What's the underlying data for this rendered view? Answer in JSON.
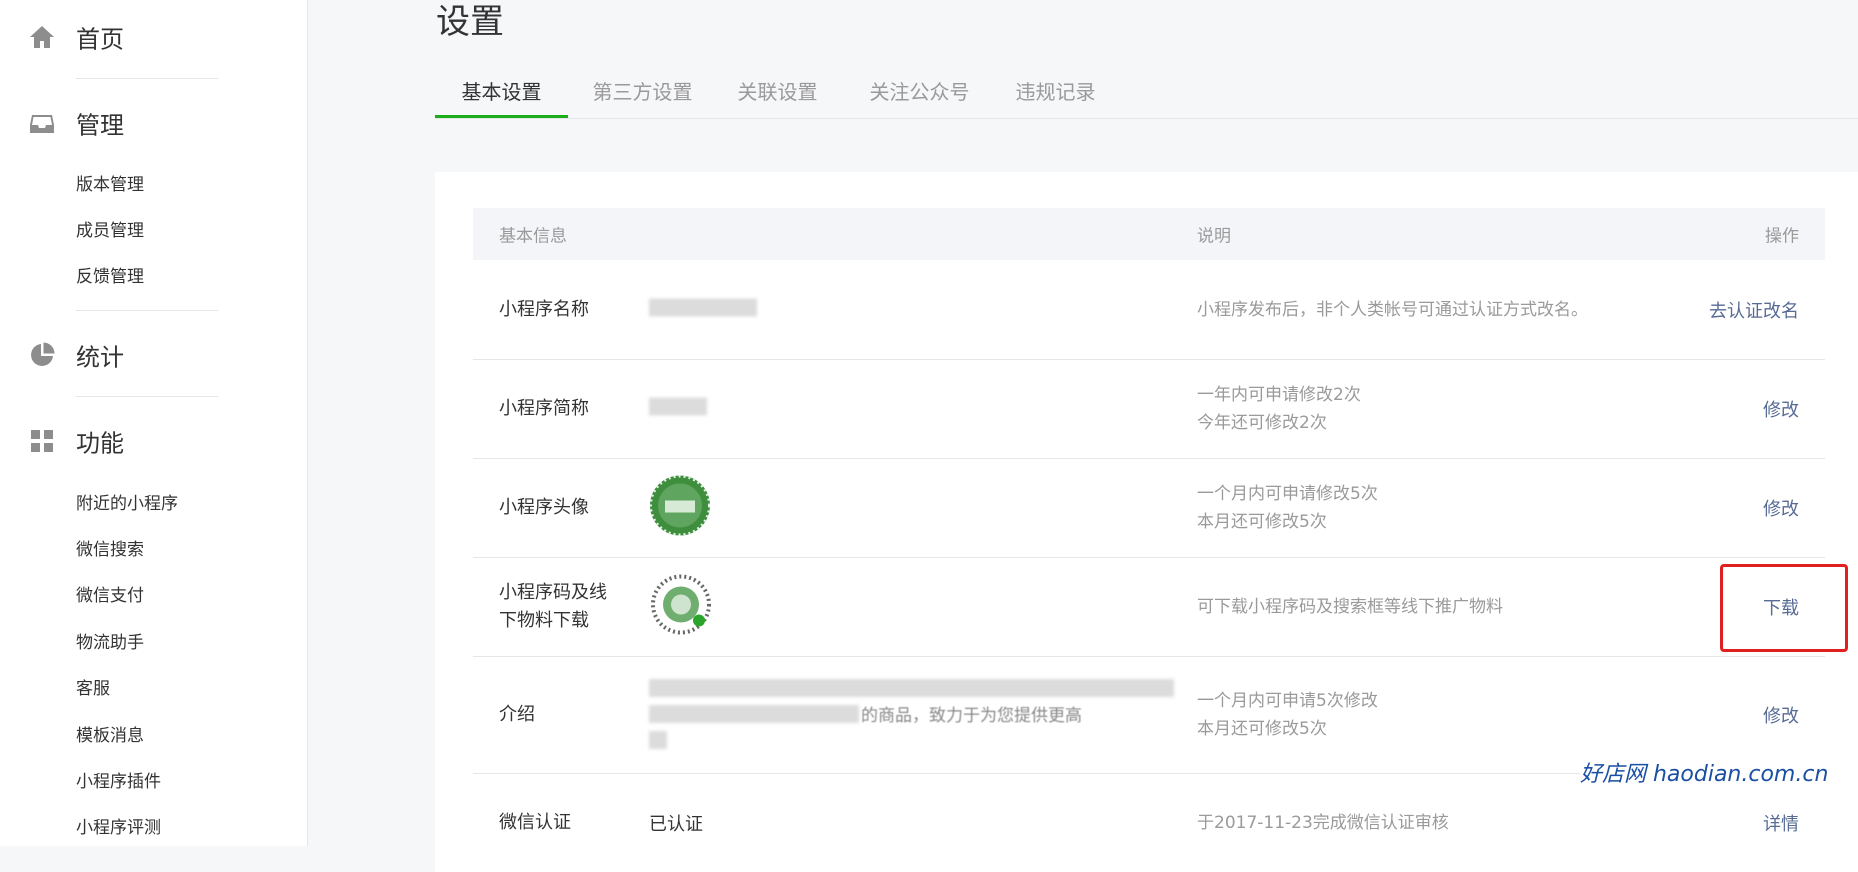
{
  "sidebar": {
    "home": {
      "label": "首页",
      "icon": "home-icon"
    },
    "manage": {
      "label": "管理",
      "icon": "inbox-icon",
      "items": [
        "版本管理",
        "成员管理",
        "反馈管理"
      ]
    },
    "stats": {
      "label": "统计",
      "icon": "pie-chart-icon"
    },
    "features": {
      "label": "功能",
      "icon": "grid-icon",
      "items": [
        "附近的小程序",
        "微信搜索",
        "微信支付",
        "物流助手",
        "客服",
        "模板消息",
        "小程序插件",
        "小程序评测"
      ]
    }
  },
  "page": {
    "title": "设置"
  },
  "tabs": [
    "基本设置",
    "第三方设置",
    "关联设置",
    "关注公众号",
    "违规记录"
  ],
  "table": {
    "headers": {
      "info": "基本信息",
      "desc": "说明",
      "action": "操作"
    },
    "rows": [
      {
        "label": "小程序名称",
        "desc": "小程序发布后，非个人类帐号可通过认证方式改名。",
        "action": "去认证改名"
      },
      {
        "label": "小程序简称",
        "desc1": "一年内可申请修改2次",
        "desc2": "今年还可修改2次",
        "action": "修改"
      },
      {
        "label": "小程序头像",
        "desc1": "一个月内可申请修改5次",
        "desc2": "本月还可修改5次",
        "action": "修改"
      },
      {
        "label1": "小程序码及线",
        "label2": "下物料下载",
        "desc": "可下载小程序码及搜索框等线下推广物料",
        "action": "下载"
      },
      {
        "label": "介绍",
        "value_fragment": "的商品，致力于为您提供更高",
        "desc1": "一个月内可申请5次修改",
        "desc2": "本月还可修改5次",
        "action": "修改"
      },
      {
        "label": "微信认证",
        "value": "已认证",
        "desc": "于2017-11-23完成微信认证审核",
        "action": "详情"
      }
    ]
  },
  "watermark": "好店网 haodian.com.cn",
  "colors": {
    "accent": "#1aad19",
    "link": "#576b95",
    "highlight": "#e02020"
  }
}
